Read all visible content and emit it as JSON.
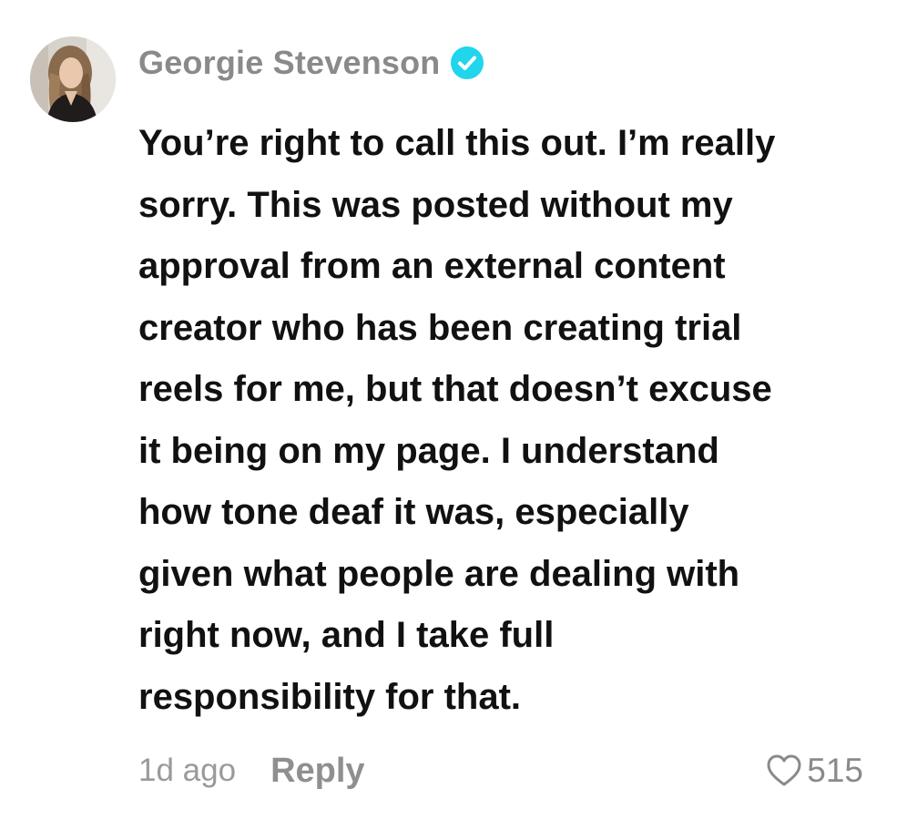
{
  "comment": {
    "author": "Georgie Stevenson",
    "verified_icon": "verified-check-icon",
    "verified_color": "#20d5ec",
    "text_lines": [
      "You’re right to call this out. I’m really",
      "sorry. This was posted without my",
      "approval from an external content",
      "creator who has been creating trial",
      "reels for me, but that doesn’t excuse",
      "it being on my page. I understand",
      "how tone deaf it was, especially",
      "given what people are dealing with",
      "right now, and I take full",
      "responsibility for that."
    ],
    "time_ago": "1d ago",
    "reply_label": "Reply",
    "like_icon": "heart-outline-icon",
    "like_count": "515"
  }
}
